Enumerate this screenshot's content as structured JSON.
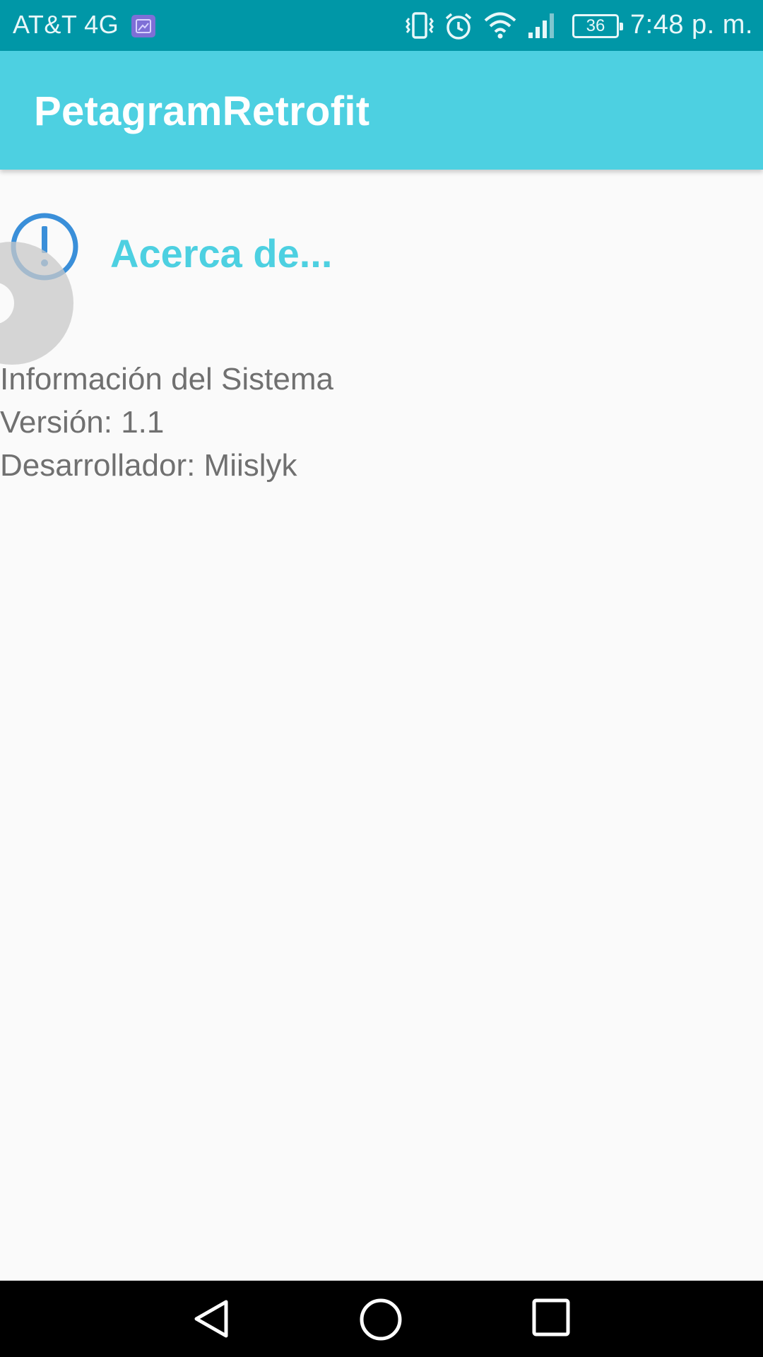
{
  "status_bar": {
    "carrier": "AT&T 4G",
    "battery": "36",
    "time": "7:48 p. m.",
    "icons": [
      "gallery-notification-icon",
      "vibrate-icon",
      "alarm-icon",
      "wifi-icon",
      "signal-icon",
      "battery-icon"
    ]
  },
  "app_bar": {
    "title": "PetagramRetrofit",
    "color": "#4dd0e1"
  },
  "content": {
    "header_icon": "info-icon",
    "header_title": "Acerca de...",
    "lines": [
      "Información del Sistema",
      "Versión: 1.1",
      "Desarrollador: Miislyk"
    ]
  },
  "nav_bar": {
    "icons": [
      "back-icon",
      "home-icon",
      "recents-icon"
    ]
  },
  "colors": {
    "status_bar": "#0097a7",
    "accent": "#4dd0e1",
    "text": "#707070"
  }
}
